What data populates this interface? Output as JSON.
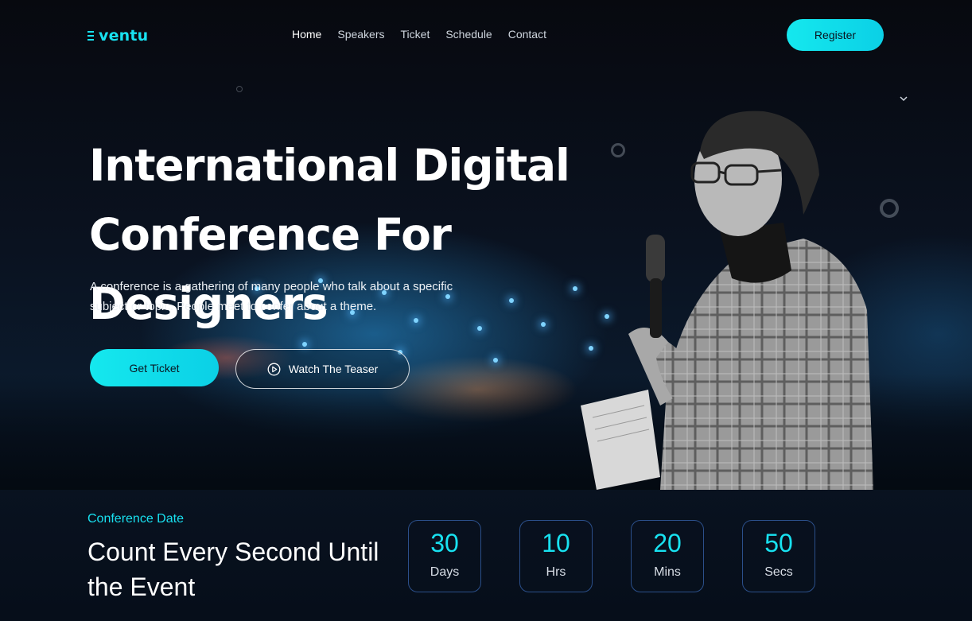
{
  "header": {
    "logo_text": "ventu",
    "nav": [
      {
        "label": "Home",
        "active": true
      },
      {
        "label": "Speakers",
        "active": false
      },
      {
        "label": "Ticket",
        "active": false
      },
      {
        "label": "Schedule",
        "active": false
      },
      {
        "label": "Contact",
        "active": false
      }
    ],
    "register_label": "Register"
  },
  "hero": {
    "title_line1": "International Digital",
    "title_line2": "Conference For Designers",
    "subtitle": "A conference is a gathering of many people who talk about a specific subject or topic. People meet to confer about a theme.",
    "get_ticket_label": "Get Ticket",
    "watch_teaser_label": "Watch The Teaser"
  },
  "countdown": {
    "label": "Conference Date",
    "title": "Count Every Second Until the Event",
    "items": [
      {
        "value": "30",
        "unit": "Days"
      },
      {
        "value": "10",
        "unit": "Hrs"
      },
      {
        "value": "20",
        "unit": "Mins"
      },
      {
        "value": "50",
        "unit": "Secs"
      }
    ]
  },
  "icons": {
    "play": "play-circle-icon",
    "chevron": "chevron-down-icon",
    "menu": "menu-lines-icon"
  },
  "colors": {
    "accent": "#18e1f0",
    "background": "#05080f",
    "box_border": "#2b4f8a"
  }
}
